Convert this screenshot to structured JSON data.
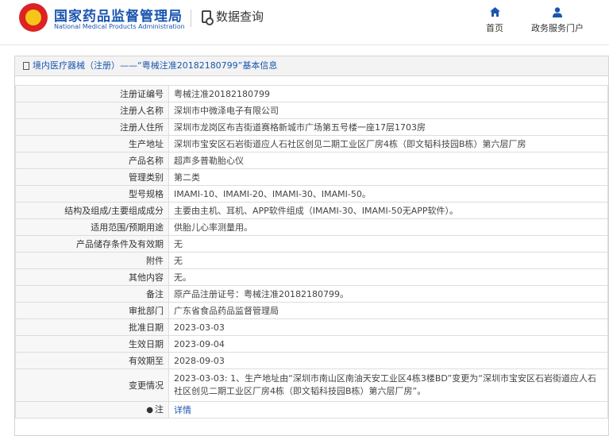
{
  "header": {
    "site_name_cn": "国家药品监督管理局",
    "site_name_en": "National Medical Products Administration",
    "section": "数据查询",
    "nav": [
      {
        "label": "首页",
        "icon": "home-icon"
      },
      {
        "label": "政务服务门户",
        "icon": "user-icon"
      }
    ]
  },
  "panel": {
    "title": "境内医疗器械（注册）——“粤械注准20182180799”基本信息"
  },
  "rows": [
    {
      "key": "注册证编号",
      "value": "粤械注准20182180799"
    },
    {
      "key": "注册人名称",
      "value": "深圳市中微泽电子有限公司"
    },
    {
      "key": "注册人住所",
      "value": "深圳市龙岗区布吉街道赛格新城市广场第五号楼一座17层1703房"
    },
    {
      "key": "生产地址",
      "value": "深圳市宝安区石岩街道应人石社区创见二期工业区厂房4栋（即文韬科技园B栋）第六层厂房"
    },
    {
      "key": "产品名称",
      "value": "超声多普勒胎心仪"
    },
    {
      "key": "管理类别",
      "value": "第二类"
    },
    {
      "key": "型号规格",
      "value": "IMAMI-10、IMAMI-20、IMAMI-30、IMAMI-50。"
    },
    {
      "key": "结构及组成/主要组成成分",
      "value": "主要由主机、耳机、APP软件组成（IMAMI-30、IMAMI-50无APP软件）。"
    },
    {
      "key": "适用范围/预期用途",
      "value": "供胎儿心率测量用。"
    },
    {
      "key": "产品储存条件及有效期",
      "value": "无"
    },
    {
      "key": "附件",
      "value": "无"
    },
    {
      "key": "其他内容",
      "value": "无。"
    },
    {
      "key": "备注",
      "value": "原产品注册证号：粤械注准20182180799。"
    },
    {
      "key": "审批部门",
      "value": "广东省食品药品监督管理局"
    },
    {
      "key": "批准日期",
      "value": "2023-03-03"
    },
    {
      "key": "生效日期",
      "value": "2023-09-04"
    },
    {
      "key": "有效期至",
      "value": "2028-09-03"
    }
  ],
  "change": {
    "key": "变更情况",
    "value": "2023-03-03: 1、生产地址由“深圳市南山区南油天安工业区4栋3楼BD”变更为“深圳市宝安区石岩街道应人石社区创见二期工业区厂房4栋（即文韬科技园B栋）第六层厂房”。"
  },
  "note": {
    "key": "注",
    "link": "详情"
  }
}
